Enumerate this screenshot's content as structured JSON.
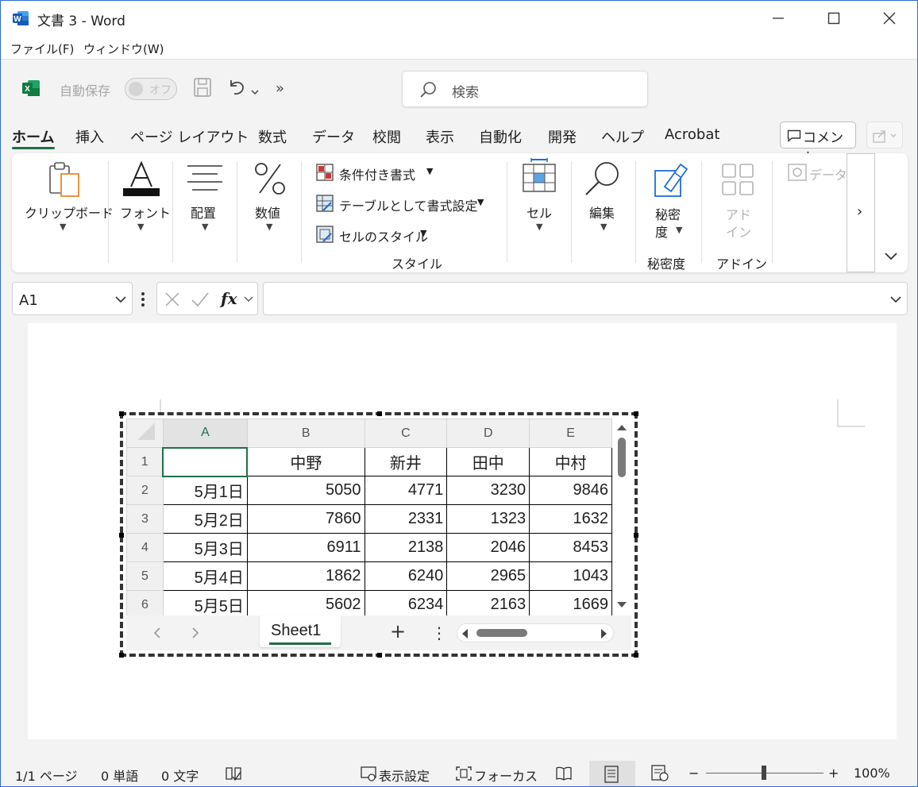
{
  "window": {
    "title": "文書 3 - Word"
  },
  "menu": {
    "file": "ファイル(F)",
    "window": "ウィンドウ(W)"
  },
  "quick_access": {
    "autosave_label": "自動保存",
    "toggle_state": "オフ",
    "more": "»"
  },
  "search": {
    "placeholder": "検索"
  },
  "tabs": [
    {
      "label": "ホーム"
    },
    {
      "label": "挿入"
    },
    {
      "label": "ページ レイアウト"
    },
    {
      "label": "数式"
    },
    {
      "label": "データ"
    },
    {
      "label": "校閲"
    },
    {
      "label": "表示"
    },
    {
      "label": "自動化"
    },
    {
      "label": "開発"
    },
    {
      "label": "ヘルプ"
    },
    {
      "label": "Acrobat"
    }
  ],
  "comment_button": "コメント",
  "ribbon": {
    "clipboard": "クリップボード",
    "font": "フォント",
    "align": "配置",
    "number": "数値",
    "conditional": "条件付き書式",
    "as_table": "テーブルとして書式設定",
    "cell_styles": "セルのスタイル",
    "styles_group": "スタイル",
    "cells": "セル",
    "editing": "編集",
    "sensitivity_line1": "秘密",
    "sensitivity_line2": "度",
    "sensitivity_group": "秘密度",
    "addin_line1": "アド",
    "addin_line2": "イン",
    "addin_group": "アドイン",
    "data_analysis": "データ",
    "more": "›"
  },
  "formula_bar": {
    "name_box": "A1",
    "fx": "fx",
    "value": ""
  },
  "sheet": {
    "columns": [
      "A",
      "B",
      "C",
      "D",
      "E"
    ],
    "selected_column": "A",
    "header_row": {
      "row": "1",
      "a": "",
      "b": "中野",
      "c": "新井",
      "d": "田中",
      "e": "中村"
    },
    "rows": [
      {
        "row": "2",
        "a": "5月1日",
        "b": "5050",
        "c": "4771",
        "d": "3230",
        "e": "9846"
      },
      {
        "row": "3",
        "a": "5月2日",
        "b": "7860",
        "c": "2331",
        "d": "1323",
        "e": "1632"
      },
      {
        "row": "4",
        "a": "5月3日",
        "b": "6911",
        "c": "2138",
        "d": "2046",
        "e": "8453"
      },
      {
        "row": "5",
        "a": "5月4日",
        "b": "1862",
        "c": "6240",
        "d": "2965",
        "e": "1043"
      },
      {
        "row": "6",
        "a": "5月5日",
        "b": "5602",
        "c": "6234",
        "d": "2163",
        "e": "1669"
      }
    ],
    "tab_name": "Sheet1",
    "add_sheet": "+",
    "more": "⋮"
  },
  "status": {
    "page": "1/1 ページ",
    "words": "0 単語",
    "chars": "0 文字",
    "display_settings": "表示設定",
    "focus": "フォーカス",
    "zoom_minus": "−",
    "zoom_plus": "+",
    "zoom": "100%"
  },
  "colors": {
    "excel_green": "#1e7145",
    "word_blue": "#2b579a",
    "window_border": "#2b6bd6"
  }
}
